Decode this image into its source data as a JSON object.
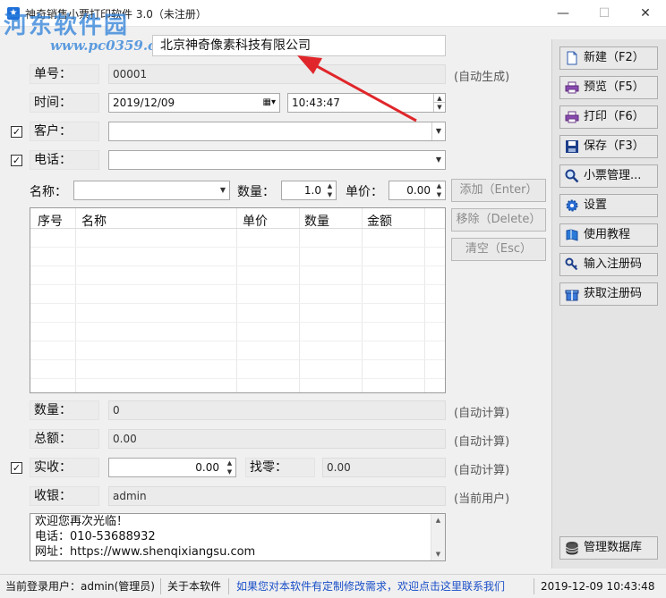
{
  "window": {
    "title": "神奇销售小票打印软件 3.0（未注册）",
    "watermark_main": "河东软件园",
    "watermark_url": "www.pc0359.cn",
    "minimize": "—",
    "maximize": "☐",
    "close": "✕"
  },
  "company": {
    "name": "北京神奇像素科技有限公司"
  },
  "fields": {
    "order_no": {
      "label": "单号：",
      "value": "00001",
      "hint": "(自动生成)"
    },
    "time": {
      "label": "时间：",
      "date": "2019/12/09",
      "clock": "10:43:47"
    },
    "customer": {
      "label": "客户：",
      "value": ""
    },
    "phone": {
      "label": "电话：",
      "value": ""
    }
  },
  "item_entry": {
    "name_label": "名称：",
    "name_value": "",
    "qty_label": "数量：",
    "qty_value": "1.0",
    "price_label": "单价：",
    "price_value": "0.00"
  },
  "actions": {
    "add": "添加（Enter）",
    "remove": "移除（Delete）",
    "clear": "清空（Esc）"
  },
  "table": {
    "headers": [
      "序号",
      "名称",
      "单价",
      "数量",
      "金额"
    ],
    "rows": []
  },
  "summary": {
    "quantity": {
      "label": "数量：",
      "value": "0",
      "hint": "(自动计算)"
    },
    "total": {
      "label": "总额：",
      "value": "0.00",
      "hint": "(自动计算)"
    },
    "received": {
      "label": "实收：",
      "value": "0.00",
      "hint": "(自动计算)"
    },
    "change": {
      "label": "找零：",
      "value": "0.00"
    },
    "cashier": {
      "label": "收银：",
      "value": "admin",
      "hint": "(当前用户)"
    }
  },
  "memo": {
    "lines": [
      "欢迎您再次光临！",
      "电话：010-53688932",
      "网址：https://www.shenqixiangsu.com"
    ]
  },
  "right_buttons": [
    {
      "label": "新建（F2）",
      "icon": "new-document-icon"
    },
    {
      "label": "预览（F5）",
      "icon": "printer-preview-icon"
    },
    {
      "label": "打印（F6）",
      "icon": "printer-icon"
    },
    {
      "label": "保存（F3）",
      "icon": "floppy-disk-icon"
    },
    {
      "label": "小票管理...",
      "icon": "magnifier-icon"
    },
    {
      "label": "设置",
      "icon": "gear-icon"
    },
    {
      "label": "使用教程",
      "icon": "book-icon"
    },
    {
      "label": "输入注册码",
      "icon": "key-icon"
    },
    {
      "label": "获取注册码",
      "icon": "gift-icon"
    }
  ],
  "db_button": {
    "label": "管理数据库",
    "icon": "database-icon"
  },
  "status": {
    "user": "当前登录用户：admin(管理员)",
    "about": "关于本软件",
    "link": "如果您对本软件有定制修改需求，欢迎点击这里联系我们",
    "datetime": "2019-12-09  10:43:48"
  },
  "colors": {
    "link": "#1a4fc8",
    "accent": "#2b7fd8",
    "arrow": "#e0262a"
  }
}
